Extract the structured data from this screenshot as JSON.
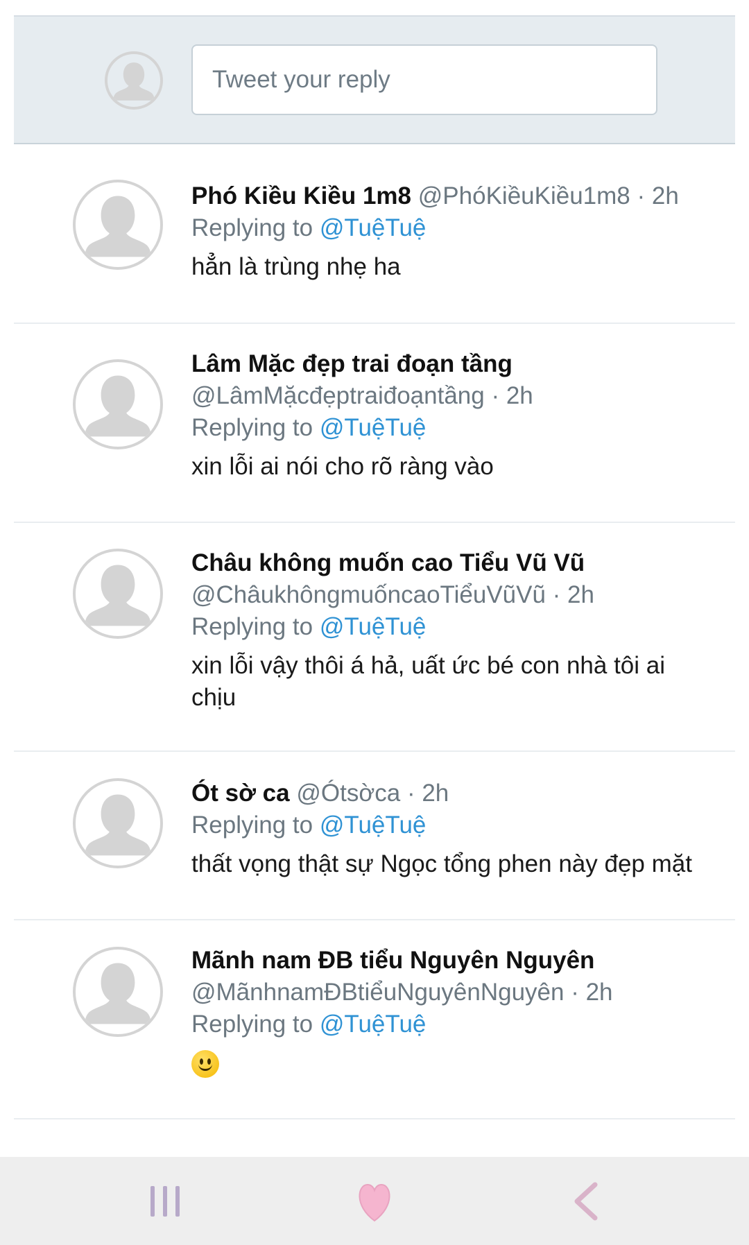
{
  "reply": {
    "placeholder": "Tweet your reply"
  },
  "replies": [
    {
      "name": "Phó Kiều Kiều 1m8",
      "handle_meta": "@PhóKiềuKiều1m8 · 2h",
      "replying_label": "Replying to ",
      "replying_to": "@TuệTuệ",
      "text": "hẳn là trùng nhẹ ha"
    },
    {
      "name": "Lâm Mặc đẹp trai đoạn tầng",
      "handle_meta": "@LâmMặcđẹptraiđoạntầng · 2h",
      "replying_label": "Replying to ",
      "replying_to": "@TuệTuệ",
      "text": "xin lỗi ai nói cho rõ ràng vào"
    },
    {
      "name": "Châu không muốn cao Tiểu Vũ Vũ",
      "handle_meta": "@ChâukhôngmuốncaoTiểuVũVũ · 2h",
      "replying_label": "Replying to ",
      "replying_to": "@TuệTuệ",
      "text_line1": "xin lỗi vậy thôi á hả, uất ức bé con nhà tôi ai",
      "text_line2": "chịu"
    },
    {
      "name": "Ót sờ ca",
      "handle_meta": "@Ótsờca · 2h",
      "replying_label": "Replying to ",
      "replying_to": "@TuệTuệ",
      "text": "thất vọng thật sự Ngọc tổng phen này đẹp mặt"
    },
    {
      "name": "Mãnh nam ĐB tiểu Nguyên Nguyên",
      "handle_meta": "@MãnhnamĐBtiểuNguyênNguyên · 2h",
      "replying_label": "Replying to ",
      "replying_to": "@TuệTuệ",
      "emoji": "slightly-smiling-face"
    }
  ],
  "navbar": {
    "icons": [
      "recent-apps-icon",
      "heart-icon",
      "back-icon"
    ]
  },
  "colors": {
    "mention": "#2f92d4",
    "reply_bg": "#e6ecf0",
    "meta_gray": "#6b7780"
  }
}
